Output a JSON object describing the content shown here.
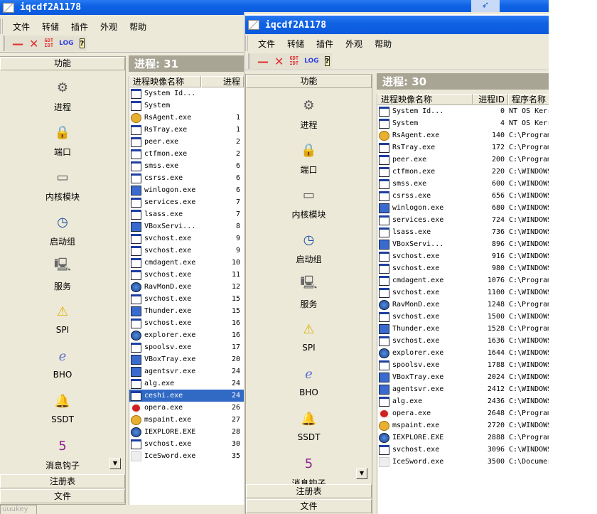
{
  "back_window": {
    "title": "iqcdf2A1178",
    "menu": [
      "文件",
      "转储",
      "插件",
      "外观",
      "帮助"
    ],
    "toolbar": {
      "min": "—",
      "close": "✕",
      "gdt": "GDT",
      "idt": "IDT",
      "log": "LOG",
      "help": "?"
    },
    "sidebar": {
      "header": "功能",
      "items": [
        {
          "label": "进程",
          "icon": "gear-icon"
        },
        {
          "label": "端口",
          "icon": "port-icon"
        },
        {
          "label": "内核模块",
          "icon": "drive-icon"
        },
        {
          "label": "启动组",
          "icon": "clock-icon"
        },
        {
          "label": "服务",
          "icon": "computer-icon"
        },
        {
          "label": "SPI",
          "icon": "warning-icon"
        },
        {
          "label": "BHO",
          "icon": "ie-folder-icon"
        },
        {
          "label": "SSDT",
          "icon": "bell-icon"
        },
        {
          "label": "消息钩子",
          "icon": "hook-icon"
        }
      ],
      "bottom": [
        "注册表",
        "文件"
      ],
      "footer_tab": "uuukey"
    },
    "process_count": "进程: 31",
    "columns": [
      "进程映像名称",
      "进程"
    ],
    "rows": [
      [
        "System Id...",
        ""
      ],
      [
        "System",
        ""
      ],
      [
        "RsAgent.exe",
        "1"
      ],
      [
        "RsTray.exe",
        "1"
      ],
      [
        "peer.exe",
        "2"
      ],
      [
        "ctfmon.exe",
        "2"
      ],
      [
        "smss.exe",
        "6"
      ],
      [
        "csrss.exe",
        "6"
      ],
      [
        "winlogon.exe",
        "6"
      ],
      [
        "services.exe",
        "7"
      ],
      [
        "lsass.exe",
        "7"
      ],
      [
        "VBoxServi...",
        "8"
      ],
      [
        "svchost.exe",
        "9"
      ],
      [
        "svchost.exe",
        "9"
      ],
      [
        "cmdagent.exe",
        "10"
      ],
      [
        "svchost.exe",
        "11"
      ],
      [
        "RavMonD.exe",
        "12"
      ],
      [
        "svchost.exe",
        "15"
      ],
      [
        "Thunder.exe",
        "15"
      ],
      [
        "svchost.exe",
        "16"
      ],
      [
        "explorer.exe",
        "16"
      ],
      [
        "spoolsv.exe",
        "17"
      ],
      [
        "VBoxTray.exe",
        "20"
      ],
      [
        "agentsvr.exe",
        "24"
      ],
      [
        "alg.exe",
        "24"
      ],
      [
        "ceshi.exe",
        "24"
      ],
      [
        "opera.exe",
        "26"
      ],
      [
        "mspaint.exe",
        "27"
      ],
      [
        "IEXPLORE.EXE",
        "28"
      ],
      [
        "svchost.exe",
        "30"
      ],
      [
        "IceSword.exe",
        "35"
      ]
    ],
    "selected_row": 25
  },
  "front_window": {
    "title": "iqcdf2A1178",
    "menu": [
      "文件",
      "转储",
      "插件",
      "外观",
      "帮助"
    ],
    "toolbar": {
      "min": "—",
      "close": "✕",
      "gdt": "GDT",
      "idt": "IDT",
      "log": "LOG",
      "help": "?"
    },
    "sidebar": {
      "header": "功能",
      "items": [
        {
          "label": "进程",
          "icon": "gear-icon"
        },
        {
          "label": "端口",
          "icon": "port-icon"
        },
        {
          "label": "内核模块",
          "icon": "drive-icon"
        },
        {
          "label": "启动组",
          "icon": "clock-icon"
        },
        {
          "label": "服务",
          "icon": "computer-icon"
        },
        {
          "label": "SPI",
          "icon": "warning-icon"
        },
        {
          "label": "BHO",
          "icon": "ie-folder-icon"
        },
        {
          "label": "SSDT",
          "icon": "bell-icon"
        },
        {
          "label": "消息钩子",
          "icon": "hook-icon"
        }
      ],
      "bottom": [
        "注册表",
        "文件"
      ]
    },
    "process_count": "进程: 30",
    "columns": [
      "进程映像名称",
      "进程ID",
      "程序名称"
    ],
    "rows": [
      [
        "System Id...",
        "0",
        "NT OS Kerr"
      ],
      [
        "System",
        "4",
        "NT OS Kerr"
      ],
      [
        "RsAgent.exe",
        "140",
        "C:\\Program"
      ],
      [
        "RsTray.exe",
        "172",
        "C:\\Program"
      ],
      [
        "peer.exe",
        "200",
        "C:\\Program"
      ],
      [
        "ctfmon.exe",
        "220",
        "C:\\WINDOWS"
      ],
      [
        "smss.exe",
        "600",
        "C:\\WINDOWS"
      ],
      [
        "csrss.exe",
        "656",
        "C:\\WINDOWS"
      ],
      [
        "winlogon.exe",
        "680",
        "C:\\WINDOWS"
      ],
      [
        "services.exe",
        "724",
        "C:\\WINDOWS"
      ],
      [
        "lsass.exe",
        "736",
        "C:\\WINDOWS"
      ],
      [
        "VBoxServi...",
        "896",
        "C:\\WINDOWS"
      ],
      [
        "svchost.exe",
        "916",
        "C:\\WINDOWS"
      ],
      [
        "svchost.exe",
        "980",
        "C:\\WINDOWS"
      ],
      [
        "cmdagent.exe",
        "1076",
        "C:\\Program"
      ],
      [
        "svchost.exe",
        "1100",
        "C:\\WINDOWS"
      ],
      [
        "RavMonD.exe",
        "1248",
        "C:\\Program"
      ],
      [
        "svchost.exe",
        "1500",
        "C:\\WINDOWS"
      ],
      [
        "Thunder.exe",
        "1528",
        "C:\\Program"
      ],
      [
        "svchost.exe",
        "1636",
        "C:\\WINDOWS"
      ],
      [
        "explorer.exe",
        "1644",
        "C:\\WINDOWS"
      ],
      [
        "spoolsv.exe",
        "1788",
        "C:\\WINDOWS"
      ],
      [
        "VBoxTray.exe",
        "2024",
        "C:\\WINDOWS"
      ],
      [
        "agentsvr.exe",
        "2412",
        "C:\\WINDOWS"
      ],
      [
        "alg.exe",
        "2436",
        "C:\\WINDOWS"
      ],
      [
        "opera.exe",
        "2648",
        "C:\\Program"
      ],
      [
        "mspaint.exe",
        "2720",
        "C:\\WINDOWS"
      ],
      [
        "IEXPLORE.EXE",
        "2888",
        "C:\\Program"
      ],
      [
        "svchost.exe",
        "3096",
        "C:\\WINDOWS"
      ],
      [
        "IceSword.exe",
        "3500",
        "C:\\Documer"
      ]
    ]
  },
  "row_icons": {
    "RsAgent.exe": "gold",
    "RsTray.exe": "plain",
    "ctfmon.exe": "plain",
    "winlogon.exe": "blue",
    "VBoxServi...": "blue",
    "RavMonD.exe": "globe",
    "Thunder.exe": "blue",
    "explorer.exe": "globe",
    "VBoxTray.exe": "blue",
    "agentsvr.exe": "blue",
    "opera.exe": "red",
    "mspaint.exe": "gold",
    "IEXPLORE.EXE": "globe",
    "IceSword.exe": "blank"
  },
  "colors": {
    "titlebar": "#0f62e4",
    "selection": "#316ac5",
    "procbar": "#a8a595"
  }
}
